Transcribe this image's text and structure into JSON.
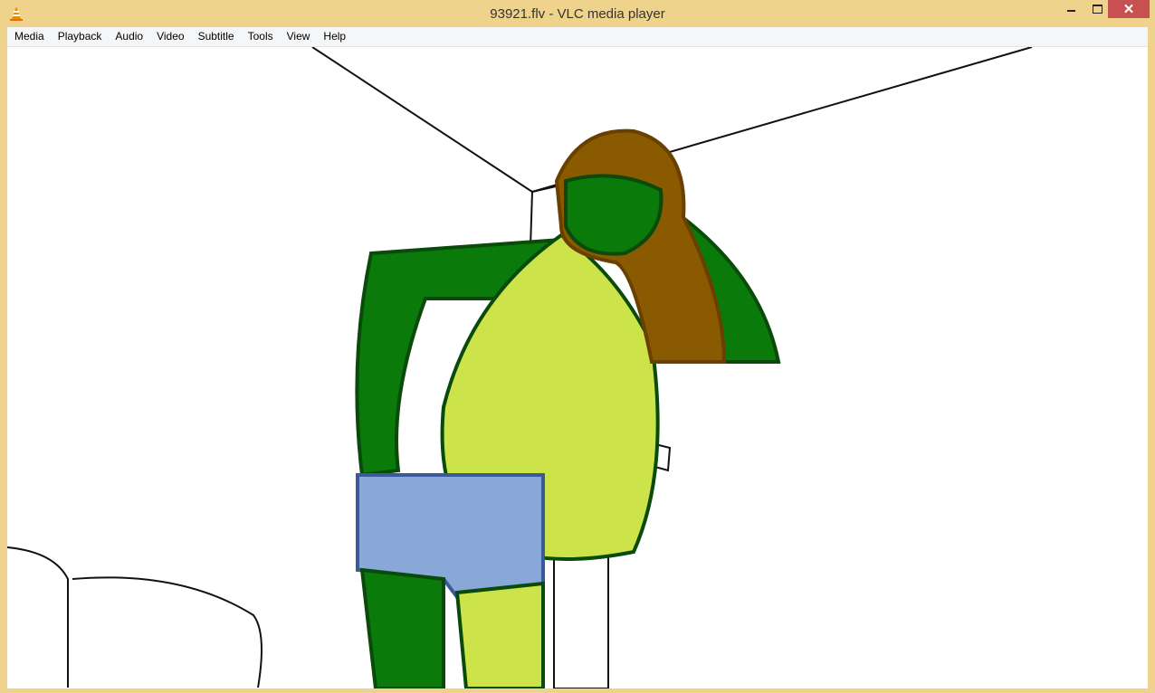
{
  "window": {
    "title": "93921.flv - VLC media player",
    "close_label": "✕"
  },
  "menu": [
    "Media",
    "Playback",
    "Audio",
    "Video",
    "Subtitle",
    "Tools",
    "View",
    "Help"
  ],
  "colors": {
    "titlebar": "#efd28b",
    "close": "#c75050",
    "skin_dark": "#0a7a0a",
    "skin_light": "#cde34a",
    "hair": "#8a5a00",
    "shorts": "#88a8d8"
  }
}
